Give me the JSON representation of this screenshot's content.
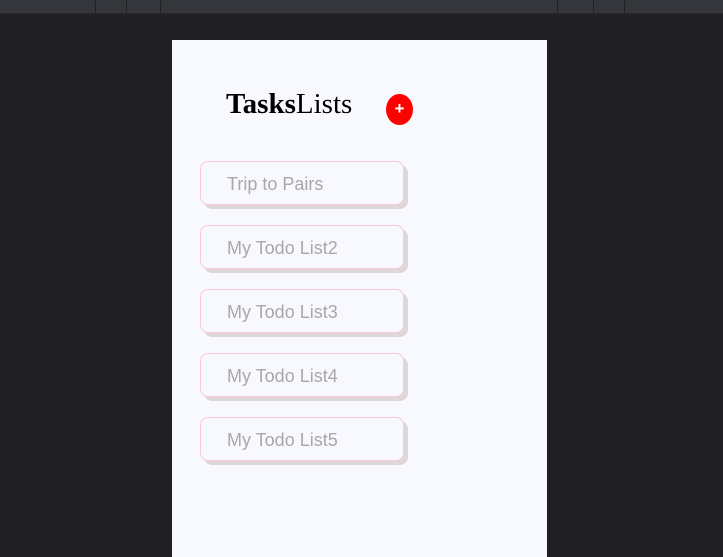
{
  "header": {
    "title_bold": "Tasks",
    "title_regular": "Lists",
    "add_label": "+"
  },
  "lists": [
    {
      "label": "Trip to Pairs"
    },
    {
      "label": "My Todo List2"
    },
    {
      "label": "My Todo List3"
    },
    {
      "label": "My Todo List4"
    },
    {
      "label": "My Todo List5"
    }
  ],
  "colors": {
    "add_button": "#ff0000",
    "item_border": "#ffc6d3",
    "item_text": "#a8a7ac",
    "panel_bg": "#f8f8ff",
    "page_bg": "#202024"
  }
}
